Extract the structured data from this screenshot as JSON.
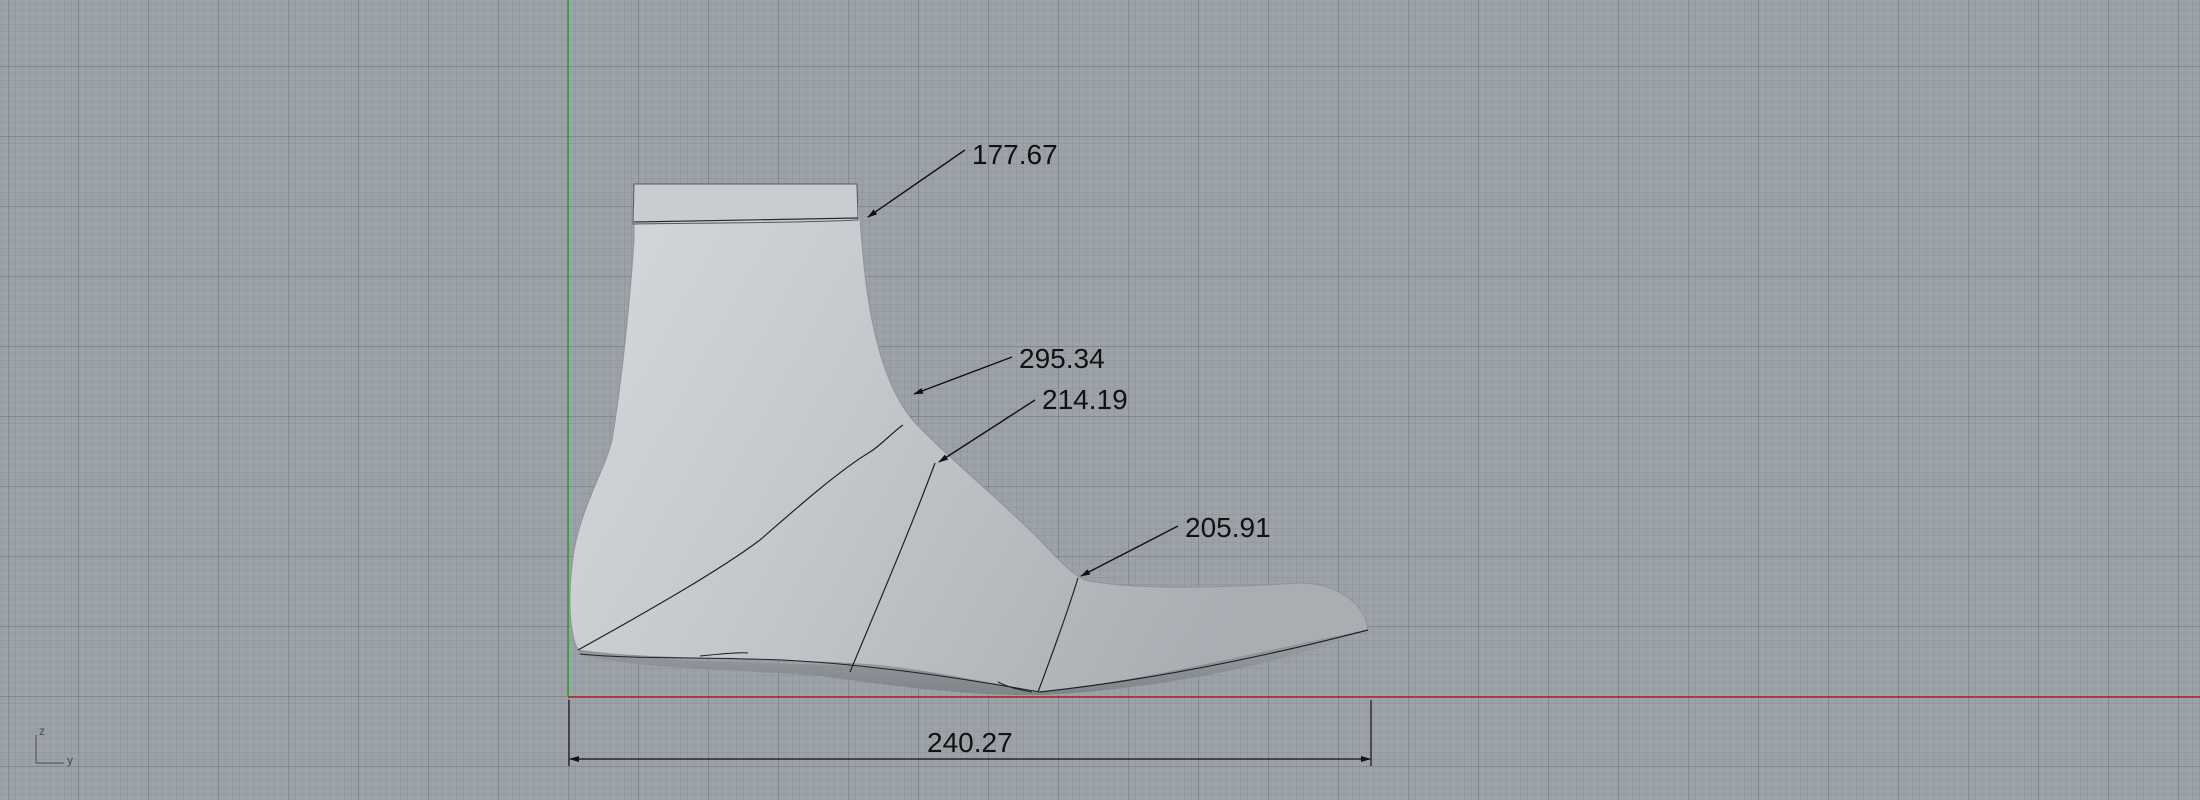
{
  "dimensions": {
    "top_opening": "177.67",
    "instep_upper": "295.34",
    "instep_lower": "214.19",
    "ball": "205.91",
    "length": "240.27"
  },
  "axis_gizmo": {
    "up_label": "z",
    "right_label": "y"
  },
  "colors": {
    "background": "#9ca2a8",
    "x_axis": "#b02020",
    "z_axis": "#2aa02a",
    "dimension": "#111111"
  }
}
